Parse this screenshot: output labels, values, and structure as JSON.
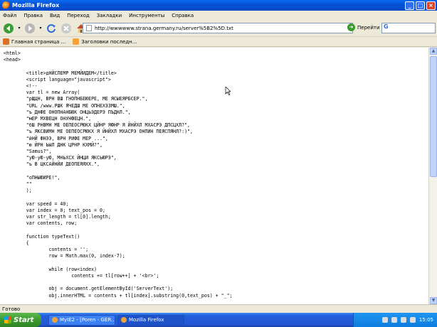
{
  "window": {
    "title": "Mozilla Firefox"
  },
  "menu": [
    "Файл",
    "Правка",
    "Вид",
    "Переход",
    "Закладки",
    "Инструменты",
    "Справка"
  ],
  "nav": {
    "url": "http://wwwwww.strana.germany.ru/server%5B2%5D.txt",
    "go_label": "Перейти",
    "search_letter": "G"
  },
  "bookmarks": [
    {
      "label": "Главная страница ...",
      "icon": "firefox-icon"
    },
    {
      "label": "Заголовки последн...",
      "icon": "rss-icon"
    }
  ],
  "code_lines": [
    "<html>",
    "<head>",
    "",
    "        <title>дНЙСЛЕМР МЕМЙИДЕМ</title>",
    "        <script language=\"javascript\">",
    "        <!--",
    "        var tl = new Array(",
    "        \"рЩЦН, ВРН ВШ ГНОПНБЕЮЕРЕ, МЕ ЯСЫЕЯРБСЕР.\",",
    "        \"URL /www.РШК ЯЧЕДШ МЕ ОПНЕХЭЗМШ.\",",
    "        \"ъ ДНФЕ ОНОПНАНБЮК ОНЦЬЭДЕРЭ ПЪДНЛ.\",",
    "        \"мЕР МХВЕЦН ОНУНФЕЦН.\",",
    "        \"бШ РНВМН МЕ ОЕПЕОСРЮКХ ЦЙНР ЯФНР Я ЙНЙХЛ МХАСРЭ ДПСЦХЛ?\",",
    "        \"ъ ЯКСВИМН МЕ ОЕПЕОСРЮКХ Я ЙНЙХЛ МХАСРЭ ОНПИН ПЕЯСПЯНЛ?:)\",",
    "        \"йНЙ ФНЭЭ, ВРН РИФЕ МЕР ...\",",
    "        \"ю ЙРН ЬЫЛ ДНК ЦРНР КХМЙ?\",",
    "        \"Samus?\",",
    "        \"уЮ-уЮ-уЮ, МНЬХСХ ЙНЦИ ЯКСЬЮРЭ\",",
    "        \"ъ В ЦКСАЙНЙИ ДЕОПЕЯЯХХ.\",",
    "",
    "        \"оПНЫЮИРЕ!\",",
    "        \"\"",
    "        );",
    "",
    "        var speed = 40;",
    "        var index = 0; text_pos = 0;",
    "        var str_length = tl[0].length;",
    "        var contents, row;",
    "",
    "        function typeText()",
    "        {",
    "                contents = '';",
    "                row = Math.max(0, index-7);",
    "",
    "                while (row<index)",
    "                        contents += tl[row++] + '<br>';",
    "",
    "                obj = document.getElementById('ServerText');",
    "                obj.innerHTML = contents + tl[index].substring(0,text_pos) + \"_\";"
  ],
  "status": {
    "text": "Готово"
  },
  "taskbar": {
    "start_label": "Start",
    "tasks": [
      {
        "label": "MyIE2 - [Poren - GER..."
      },
      {
        "label": "Mozilla Firefox"
      }
    ],
    "lang": "RU",
    "clock": "15:05"
  }
}
